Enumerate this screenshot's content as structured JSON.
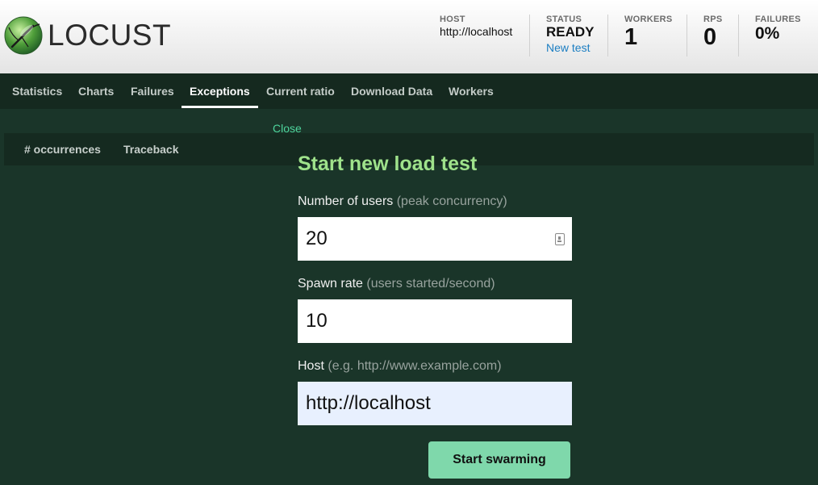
{
  "brand": {
    "name": "LOCUST",
    "logo_icon": "locust-logo-icon",
    "accent": "#9fe28b"
  },
  "header": {
    "host": {
      "label": "HOST",
      "value": "http://localhost"
    },
    "status": {
      "label": "STATUS",
      "value": "READY",
      "link": "New test"
    },
    "workers": {
      "label": "WORKERS",
      "value": "1"
    },
    "rps": {
      "label": "RPS",
      "value": "0"
    },
    "failures": {
      "label": "FAILURES",
      "value": "0%"
    }
  },
  "nav": {
    "tabs": [
      {
        "label": "Statistics"
      },
      {
        "label": "Charts"
      },
      {
        "label": "Failures"
      },
      {
        "label": "Exceptions",
        "active": true
      },
      {
        "label": "Current ratio"
      },
      {
        "label": "Download Data"
      },
      {
        "label": "Workers"
      }
    ]
  },
  "exceptions_table": {
    "columns": [
      "# occurrences",
      "Traceback"
    ]
  },
  "modal": {
    "close_label": "Close",
    "title": "Start new load test",
    "users": {
      "label": "Number of users",
      "hint": "(peak concurrency)",
      "value": "20"
    },
    "spawn_rate": {
      "label": "Spawn rate",
      "hint": "(users started/second)",
      "value": "10"
    },
    "host": {
      "label": "Host",
      "hint": "(e.g. http://www.example.com)",
      "value": "http://localhost"
    },
    "submit_label": "Start swarming"
  }
}
